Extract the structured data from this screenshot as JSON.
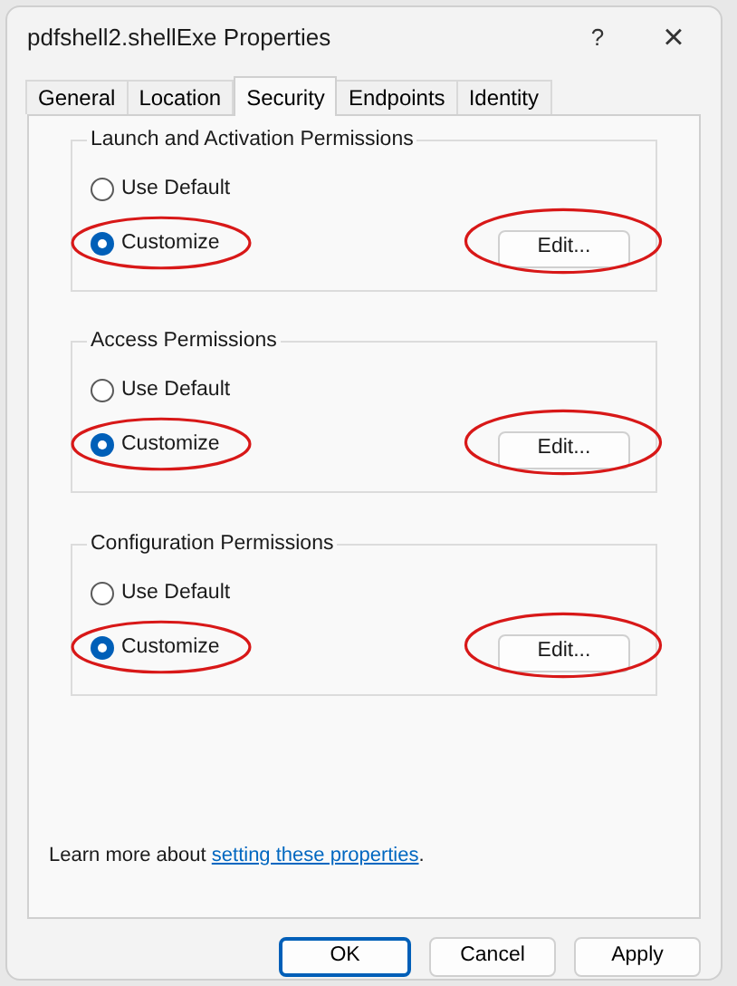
{
  "window": {
    "title": "pdfshell2.shellExe Properties",
    "help": "?",
    "close": "×"
  },
  "tabs": [
    {
      "label": "General",
      "selected": false
    },
    {
      "label": "Location",
      "selected": false
    },
    {
      "label": "Security",
      "selected": true
    },
    {
      "label": "Endpoints",
      "selected": false
    },
    {
      "label": "Identity",
      "selected": false
    }
  ],
  "groups": [
    {
      "title": "Launch and Activation Permissions",
      "options": [
        {
          "label": "Use Default",
          "selected": false,
          "circled": false
        },
        {
          "label": "Customize",
          "selected": true,
          "circled": true
        }
      ],
      "edit": {
        "label": "Edit...",
        "circled": true
      }
    },
    {
      "title": "Access Permissions",
      "options": [
        {
          "label": "Use Default",
          "selected": false,
          "circled": false
        },
        {
          "label": "Customize",
          "selected": true,
          "circled": true
        }
      ],
      "edit": {
        "label": "Edit...",
        "circled": true
      }
    },
    {
      "title": "Configuration Permissions",
      "options": [
        {
          "label": "Use Default",
          "selected": false,
          "circled": false
        },
        {
          "label": "Customize",
          "selected": true,
          "circled": true
        }
      ],
      "edit": {
        "label": "Edit...",
        "circled": true
      }
    }
  ],
  "learn_more": {
    "text": "Learn more about ",
    "link": "setting these properties",
    "end": "."
  },
  "buttons": [
    {
      "label": "OK",
      "default": true
    },
    {
      "label": "Cancel",
      "default": false
    },
    {
      "label": "Apply",
      "default": false
    }
  ]
}
